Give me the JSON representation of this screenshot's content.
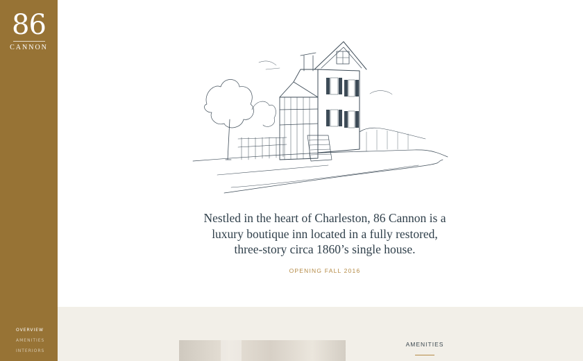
{
  "brand": {
    "number": "86",
    "word": "CANNON"
  },
  "sidebar": {
    "nav": [
      {
        "label": "OVERVIEW",
        "active": true
      },
      {
        "label": "AMENITIES",
        "active": false
      },
      {
        "label": "INTERIORS",
        "active": false
      }
    ]
  },
  "hero": {
    "illustration": "sketch-of-three-story-single-house",
    "intro_line1": "Nestled in the heart of Charleston, 86 Cannon is a",
    "intro_line2": "luxury boutique inn located in a fully restored,",
    "intro_line3": "three-story circa 1860’s single house.",
    "opening": "OPENING FALL 2016"
  },
  "amenities": {
    "heading": "AMENITIES"
  },
  "colors": {
    "sidebar": "#977335",
    "accent": "#b48a45",
    "text": "#2f3f4a",
    "lower_bg": "#f2efe8"
  }
}
